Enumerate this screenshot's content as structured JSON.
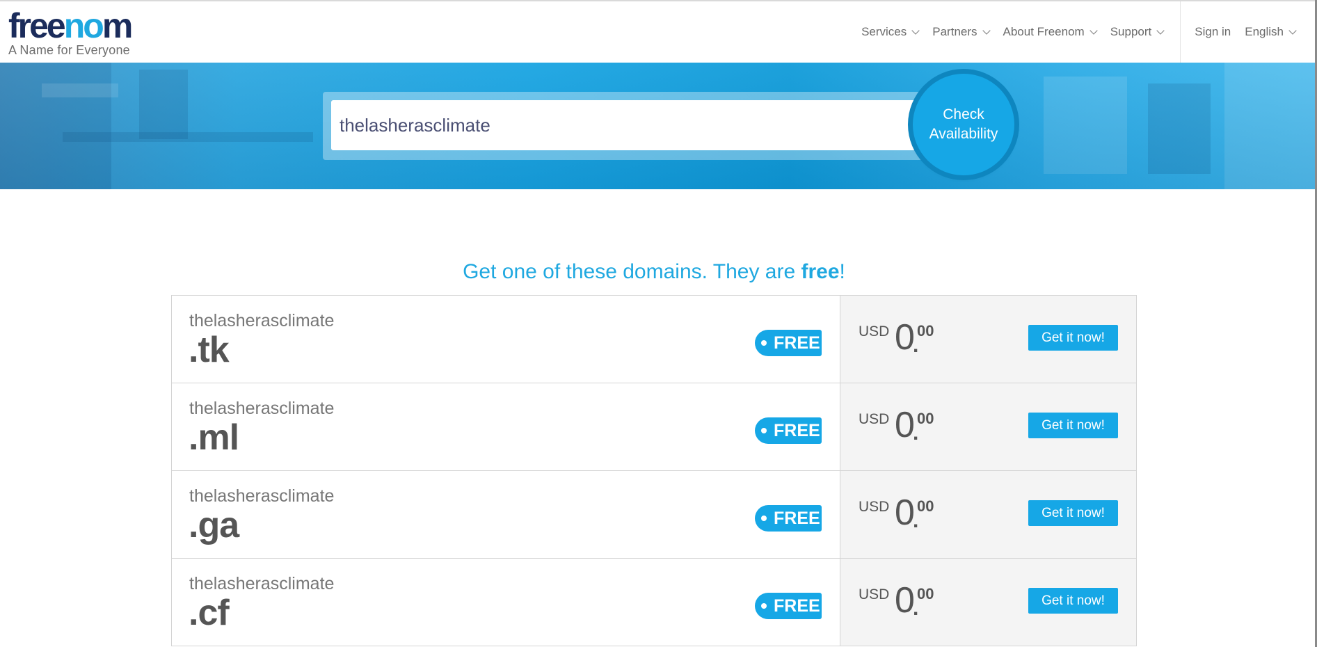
{
  "header": {
    "logo": {
      "part1": "free",
      "part2": "no",
      "part3": "m",
      "tagline": "A Name for Everyone"
    },
    "nav": [
      {
        "label": "Services"
      },
      {
        "label": "Partners"
      },
      {
        "label": "About Freenom"
      },
      {
        "label": "Support"
      }
    ],
    "sign_in": "Sign in",
    "language": "English"
  },
  "search": {
    "value": "thelasherasclimate",
    "button_line1": "Check",
    "button_line2": "Availability"
  },
  "heading": {
    "prefix": "Get one of these domains. They are ",
    "emphasis": "free",
    "suffix": "!"
  },
  "domains": [
    {
      "name": "thelasherasclimate",
      "tld": ".tk",
      "badge": "FREE",
      "currency": "USD",
      "price_whole": "0",
      "price_cents": "00",
      "action": "Get it now!"
    },
    {
      "name": "thelasherasclimate",
      "tld": ".ml",
      "badge": "FREE",
      "currency": "USD",
      "price_whole": "0",
      "price_cents": "00",
      "action": "Get it now!"
    },
    {
      "name": "thelasherasclimate",
      "tld": ".ga",
      "badge": "FREE",
      "currency": "USD",
      "price_whole": "0",
      "price_cents": "00",
      "action": "Get it now!"
    },
    {
      "name": "thelasherasclimate",
      "tld": ".cf",
      "badge": "FREE",
      "currency": "USD",
      "price_whole": "0",
      "price_cents": "00",
      "action": "Get it now!"
    }
  ],
  "colors": {
    "brand_blue": "#1fa8e0",
    "brand_navy": "#1b2c5b",
    "button_blue": "#16a7e6"
  }
}
